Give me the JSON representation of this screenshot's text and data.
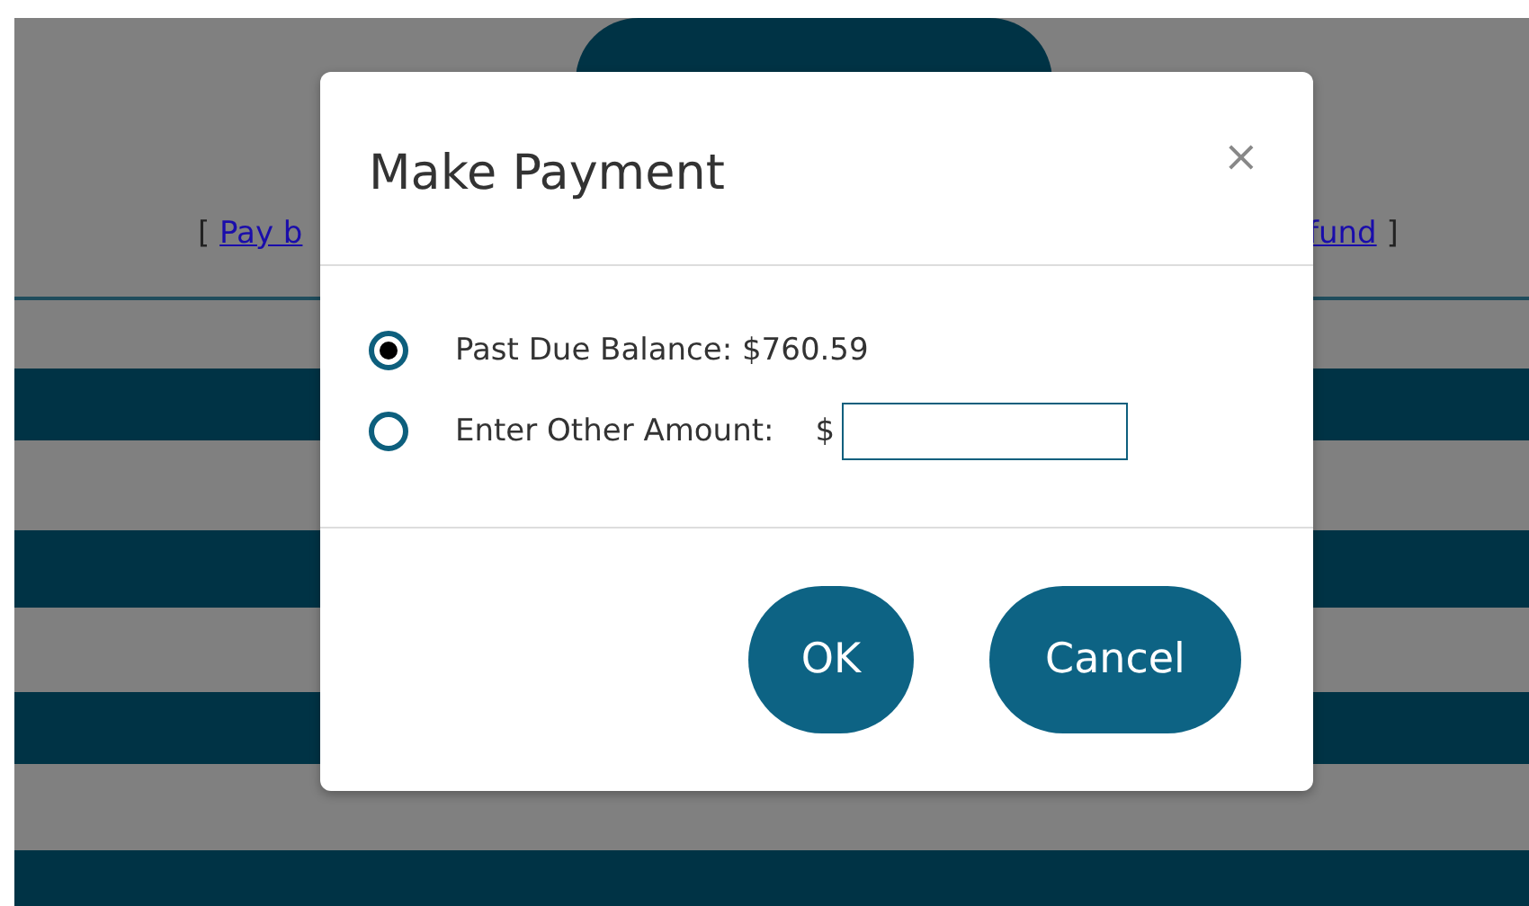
{
  "background": {
    "links": [
      {
        "prefix": "[",
        "text": "Pay b"
      },
      {
        "text": "fund",
        "suffix": "]"
      }
    ]
  },
  "dialog": {
    "title": "Make Payment",
    "close": "×",
    "options": [
      {
        "kind": "text",
        "label": "Past Due Balance: $760.59",
        "selected": true
      },
      {
        "kind": "amount",
        "label": "Enter Other Amount:",
        "currency": "$",
        "selected": false
      }
    ],
    "buttons": [
      "OK",
      "Cancel"
    ]
  }
}
